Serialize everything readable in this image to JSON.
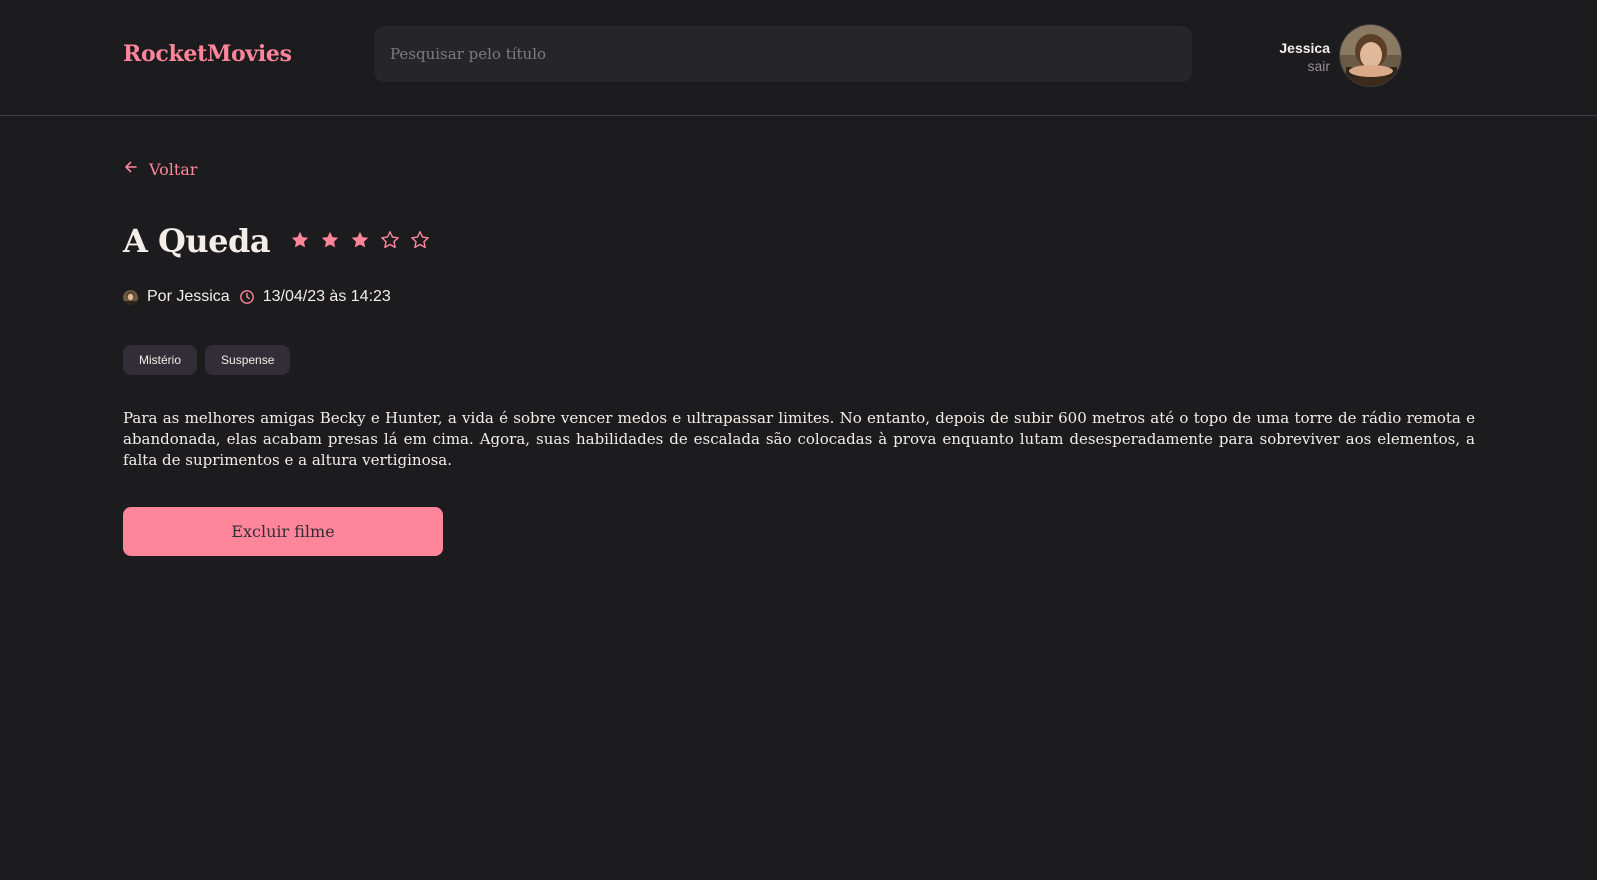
{
  "header": {
    "brand": "RocketMovies",
    "search_placeholder": "Pesquisar pelo título",
    "search_value": "",
    "profile": {
      "name": "Jessica",
      "logout": "sair"
    }
  },
  "back": {
    "label": "Voltar"
  },
  "movie": {
    "title": "A Queda",
    "rating": 3,
    "rating_max": 5,
    "author": "Por Jessica",
    "datetime": "13/04/23 às 14:23",
    "tags": [
      "Mistério",
      "Suspense"
    ],
    "description": "Para as melhores amigas Becky e Hunter, a vida é sobre vencer medos e ultrapassar limites. No entanto, depois de subir 600 metros até o topo de uma torre de rádio remota e abandonada, elas acabam presas lá em cima. Agora, suas habilidades de escalada são colocadas à prova enquanto lutam desesperadamente para sobreviver aos elementos, a falta de suprimentos e a altura vertiginosa."
  },
  "actions": {
    "delete_label": "Excluir filme"
  },
  "colors": {
    "accent": "#ff859b",
    "background": "#1c1b1e",
    "tag_background": "#312e38",
    "text": "#f4ede8"
  },
  "icons": {
    "back": "arrow-left-icon",
    "star_filled": "star-filled-icon",
    "star_empty": "star-outline-icon",
    "clock": "clock-icon"
  }
}
